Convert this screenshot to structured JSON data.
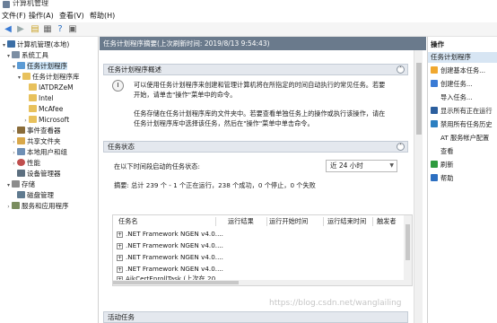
{
  "window": {
    "title": "计算机管理"
  },
  "menu": [
    "文件(F)",
    "操作(A)",
    "查看(V)",
    "帮助(H)"
  ],
  "toolbar": [
    "back-icon",
    "forward-icon",
    "up-icon",
    "properties-icon",
    "help-icon",
    "view-icon"
  ],
  "tree": [
    {
      "label": "计算机管理(本地)",
      "icon": "computer-icon"
    },
    {
      "label": "系统工具",
      "icon": "tools-icon"
    },
    {
      "label": "任务计划程序",
      "icon": "task-scheduler-icon",
      "selected": true
    },
    {
      "label": "任务计划程序库",
      "icon": "folder-icon"
    },
    {
      "label": "IATDRZeM",
      "icon": "folder-icon"
    },
    {
      "label": "Intel",
      "icon": "folder-icon"
    },
    {
      "label": "McAfee",
      "icon": "folder-icon"
    },
    {
      "label": "Microsoft",
      "icon": "folder-icon"
    },
    {
      "label": "事件查看器",
      "icon": "event-viewer-icon"
    },
    {
      "label": "共享文件夹",
      "icon": "shared-folder-icon"
    },
    {
      "label": "本地用户和组",
      "icon": "users-icon"
    },
    {
      "label": "性能",
      "icon": "performance-icon"
    },
    {
      "label": "设备管理器",
      "icon": "device-manager-icon"
    },
    {
      "label": "存储",
      "icon": "storage-icon"
    },
    {
      "label": "磁盘管理",
      "icon": "disk-icon"
    },
    {
      "label": "服务和应用程序",
      "icon": "services-icon"
    }
  ],
  "center": {
    "header": "任务计划程序摘要(上次刷新时间: 2019/8/13 9:54:43)",
    "overview": {
      "title": "任务计划程序概述",
      "para1_line1": "可以使用任务计划程序来创建和管理计算机将在所指定的时间自动执行的常见任务。若要",
      "para1_line2": "开始，请单击\"操作\"菜单中的命令。",
      "para2_line1": "任务存储在任务计划程序库的文件夹中。若要查看单独任务上的操作或执行该操作，请在",
      "para2_line2": "任务计划程序库中选择该任务，然后在\"操作\"菜单中单击命令。"
    },
    "status": {
      "title": "任务状态",
      "period_label": "在以下时间段启动的任务状态:",
      "period_value": "近 24 小时",
      "summary": "摘要: 总计 239 个 - 1 个正在运行，238 个成功，0 个停止，0 个失败"
    },
    "table": {
      "columns": [
        "任务名",
        "运行结果",
        "运行开始时间",
        "运行结束时间",
        "触发者"
      ],
      "rows": [
        ".NET Framework NGEN v4.0....",
        ".NET Framework NGEN v4.0....",
        ".NET Framework NGEN v4.0....",
        ".NET Framework NGEN v4.0....",
        "AikCertEnrollTask (上次在 20..."
      ]
    },
    "active": {
      "title": "活动任务"
    }
  },
  "actions": {
    "header": "操作",
    "subheader": "任务计划程序",
    "items": [
      {
        "label": "创建基本任务...",
        "icon": "create-basic-task-icon",
        "color": "#f0a830"
      },
      {
        "label": "创建任务...",
        "icon": "create-task-icon",
        "color": "#3a7bd5"
      },
      {
        "label": "导入任务...",
        "icon": "import-task-icon",
        "color": "#ffffff"
      },
      {
        "label": "显示所有正在运行",
        "icon": "running-tasks-icon",
        "color": "#2c5f9e"
      },
      {
        "label": "禁用所有任务历史",
        "icon": "disable-history-icon",
        "color": "#2c7fc1"
      },
      {
        "label": "AT 服务帐户配置",
        "icon": "",
        "color": "#ffffff"
      },
      {
        "label": "查看",
        "icon": "view-icon",
        "color": "#ffffff"
      },
      {
        "label": "刷新",
        "icon": "refresh-icon",
        "color": "#2e9b3e"
      },
      {
        "label": "帮助",
        "icon": "help-icon",
        "color": "#2c6fc1"
      }
    ]
  },
  "watermark": "https://blog.csdn.net/wanglailing"
}
